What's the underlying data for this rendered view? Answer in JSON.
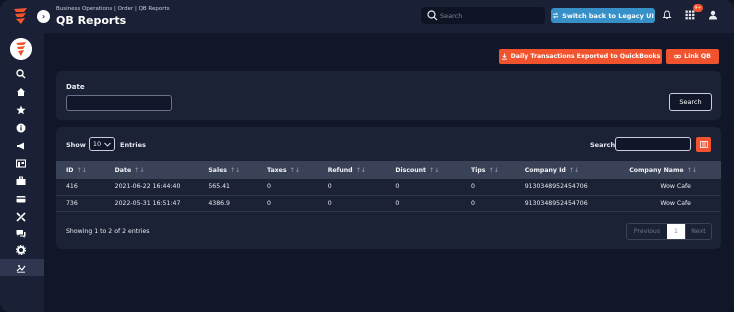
{
  "header": {
    "breadcrumb": "Business Operations | Order | QB Reports",
    "title": "QB Reports",
    "search_placeholder": "Search",
    "legacy_button": "Switch back to Legacy UI",
    "notification_badge": "9+"
  },
  "actions": {
    "export_button": "Daily Transactions Exported to QuickBooks",
    "link_button": "Link QB"
  },
  "filter": {
    "date_label": "Date",
    "date_value": "",
    "search_button": "Search"
  },
  "table_controls": {
    "show_label": "Show",
    "entries_value": "10",
    "entries_label": "Entries",
    "search_label": "Search:",
    "search_value": ""
  },
  "table": {
    "columns": [
      "ID",
      "Date",
      "Sales",
      "Taxes",
      "Refund",
      "Discount",
      "Tips",
      "Company Id",
      "Company Name"
    ],
    "rows": [
      [
        "416",
        "2021-06-22 16:44:40",
        "565.41",
        "0",
        "0",
        "0",
        "0",
        "9130348952454706",
        "Wow Cafe"
      ],
      [
        "736",
        "2022-05-31 16:51:47",
        "4386.9",
        "0",
        "0",
        "0",
        "0",
        "9130348952454706",
        "Wow Cafe"
      ]
    ]
  },
  "pagination": {
    "summary": "Showing 1 to 2 of 2 entries",
    "previous": "Previous",
    "page": "1",
    "next": "Next"
  },
  "colors": {
    "accent_orange": "#f0532d",
    "accent_blue": "#3790c7",
    "background": "#111729",
    "panel": "#1b2235"
  },
  "sidebar_icons": [
    "search-icon",
    "home-icon",
    "star-icon",
    "info-icon",
    "megaphone-icon",
    "store-icon",
    "briefcase-icon",
    "card-icon",
    "tools-icon",
    "chat-icon",
    "gear-icon",
    "reports-icon"
  ]
}
